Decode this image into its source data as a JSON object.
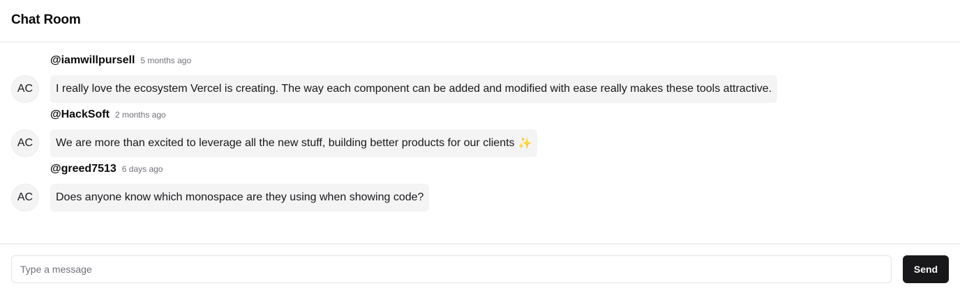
{
  "header": {
    "title": "Chat Room"
  },
  "messages": [
    {
      "avatar": "AC",
      "author": "@iamwillpursell",
      "time": "5 months ago",
      "text": "I really love the ecosystem Vercel is creating. The way each component can be added and modified with ease really makes these tools attractive.",
      "emoji": ""
    },
    {
      "avatar": "AC",
      "author": "@HackSoft",
      "time": "2 months ago",
      "text": "We are more than excited to leverage all the new stuff, building better products for our clients",
      "emoji": "✨"
    },
    {
      "avatar": "AC",
      "author": "@greed7513",
      "time": "6 days ago",
      "text": "Does anyone know which monospace are they using when showing code?",
      "emoji": ""
    }
  ],
  "composer": {
    "placeholder": "Type a message",
    "value": "",
    "send_label": "Send"
  }
}
